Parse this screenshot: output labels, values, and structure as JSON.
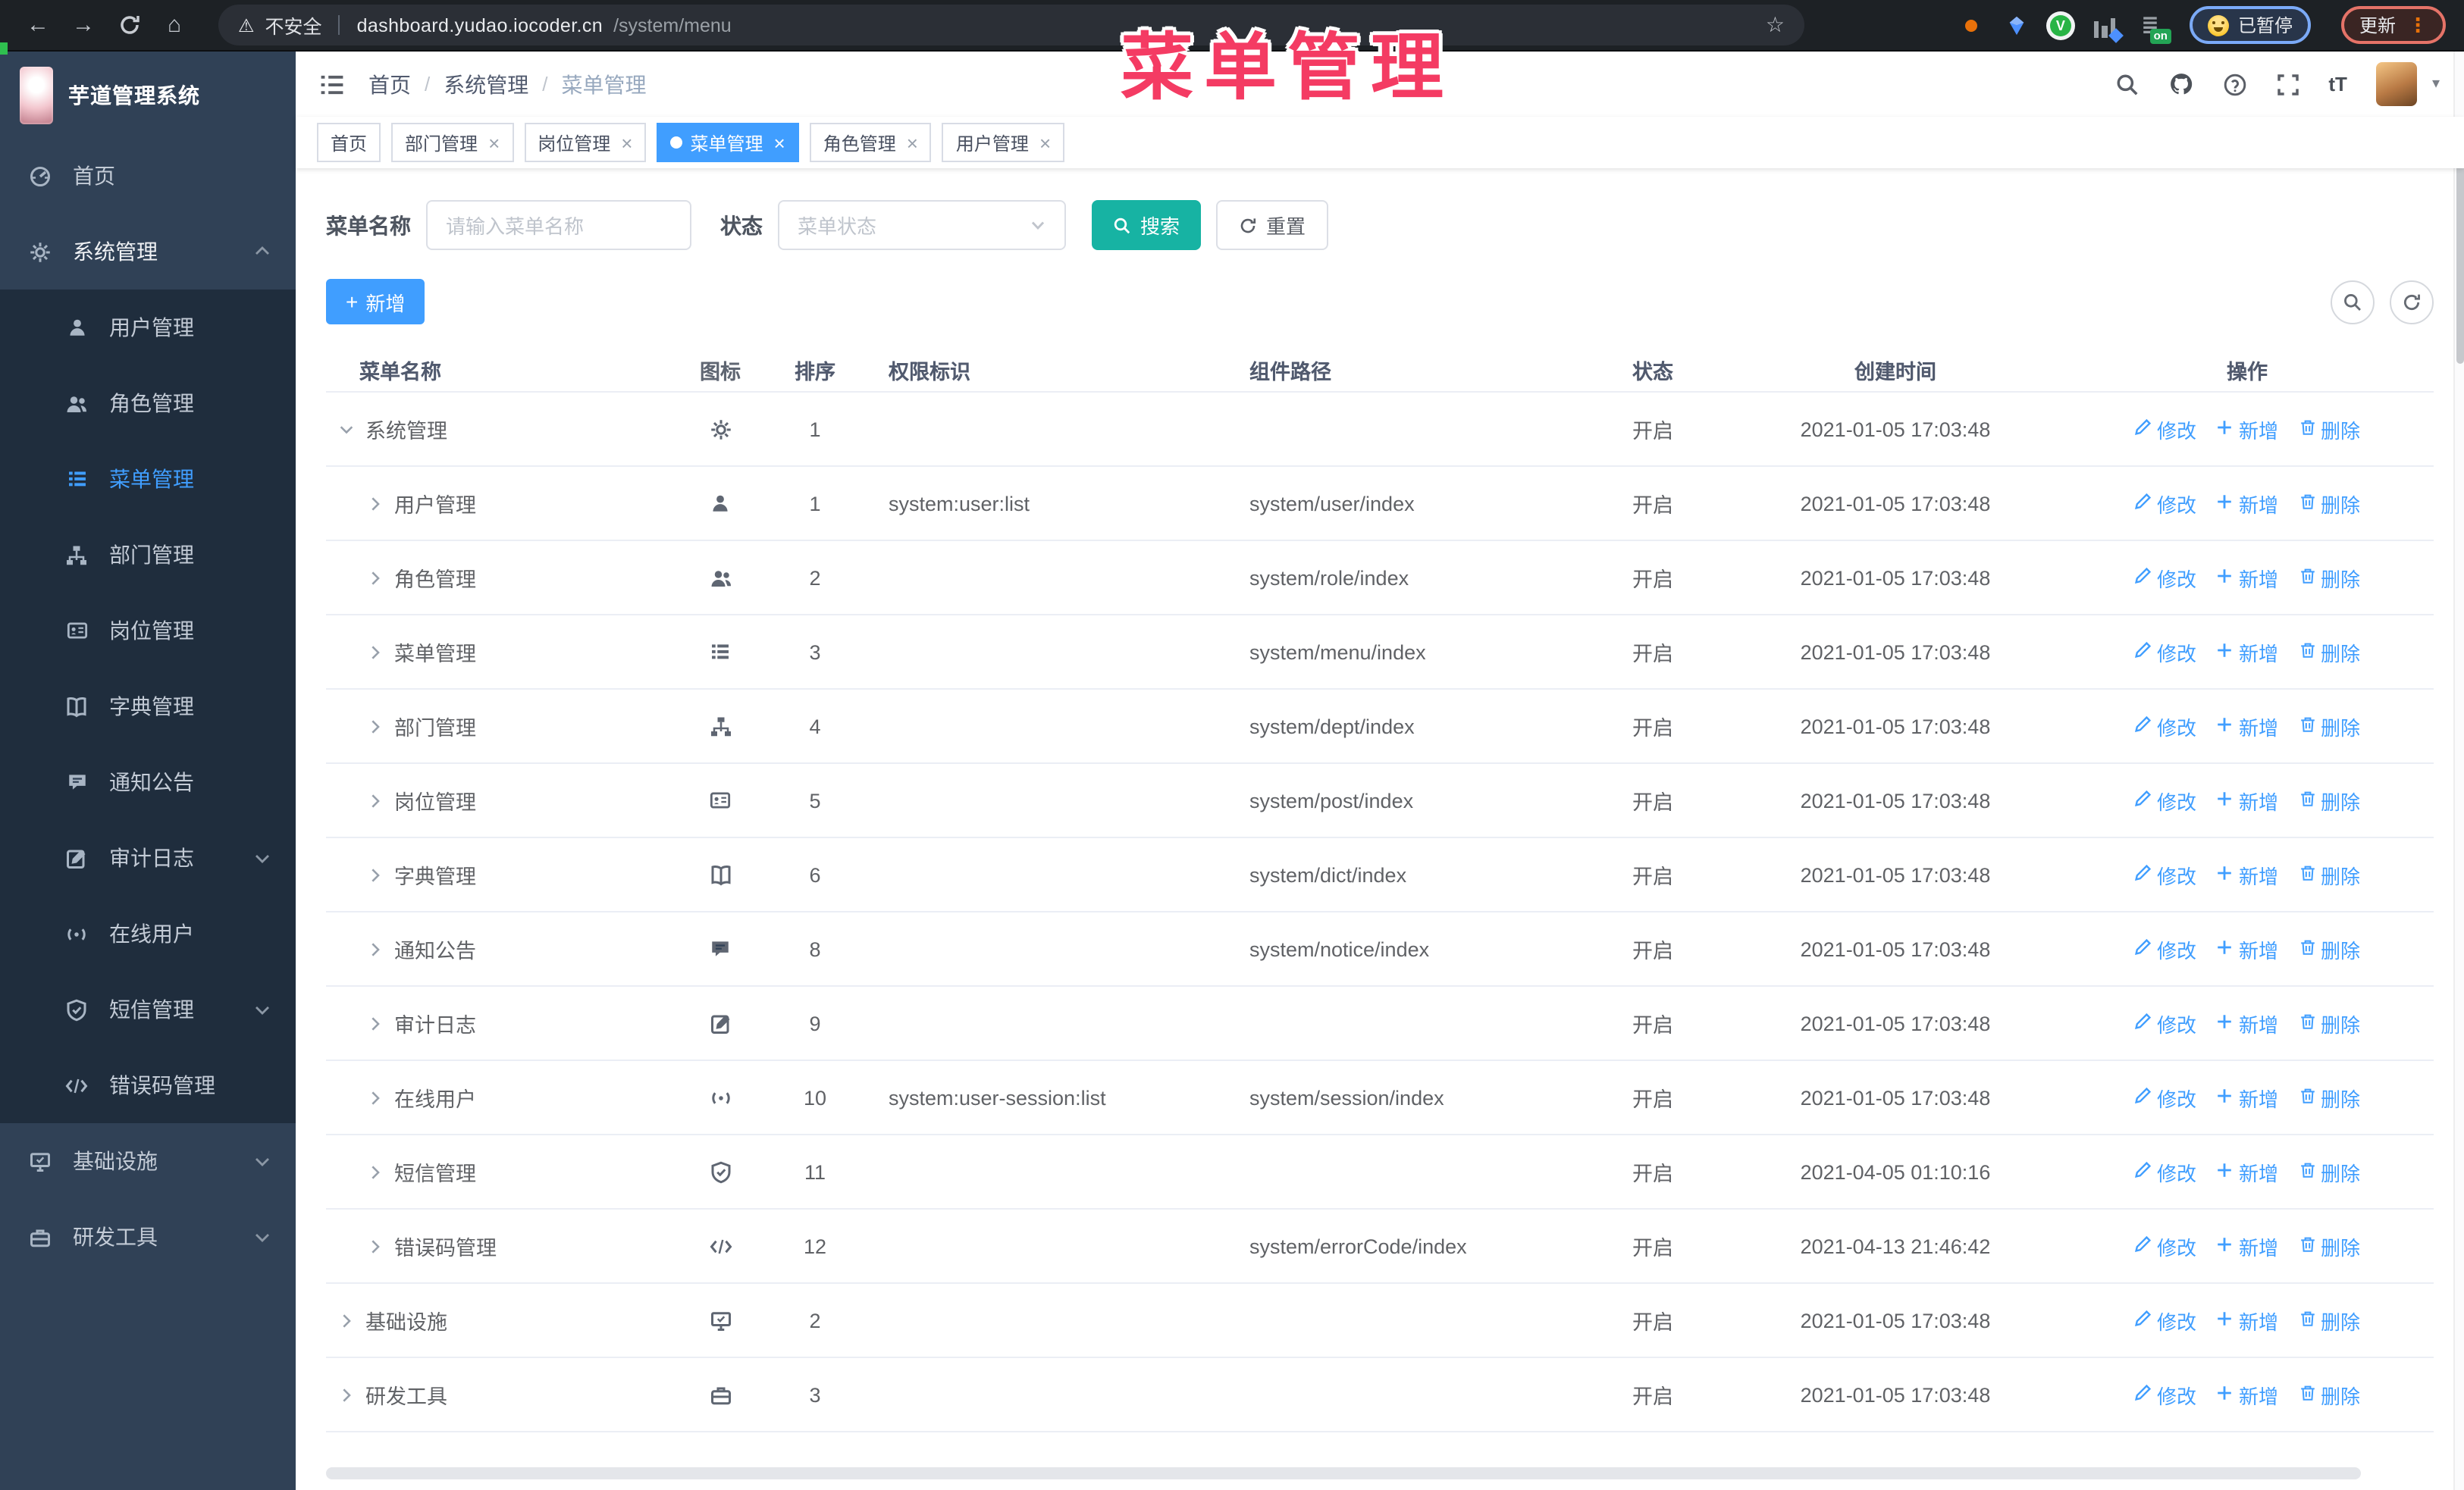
{
  "browser": {
    "security_label": "不安全",
    "url_host": "dashboard.yudao.iocoder.cn",
    "url_path": "/system/menu",
    "paused_badge": "已暂停",
    "update_button": "更新",
    "on_badge": "on"
  },
  "overlay": {
    "title": "菜单管理"
  },
  "icons": {
    "back": "←",
    "forward": "→",
    "home": "⌂",
    "star": "☆",
    "warning": "⚠",
    "more_vertical": "⋮",
    "text_size": "tT",
    "caret_down": "▾",
    "green_v": "V",
    "bars": "≣"
  },
  "sidebar": {
    "app_title": "芋道管理系统",
    "items": [
      {
        "label": "首页",
        "icon": "dashboard",
        "sub": false
      },
      {
        "label": "系统管理",
        "icon": "gear",
        "sub": false,
        "parent": true,
        "chevron": "up"
      },
      {
        "label": "用户管理",
        "icon": "user",
        "sub": true
      },
      {
        "label": "角色管理",
        "icon": "users",
        "sub": true
      },
      {
        "label": "菜单管理",
        "icon": "menu",
        "sub": true,
        "active": true
      },
      {
        "label": "部门管理",
        "icon": "tree",
        "sub": true
      },
      {
        "label": "岗位管理",
        "icon": "post",
        "sub": true
      },
      {
        "label": "字典管理",
        "icon": "dict",
        "sub": true
      },
      {
        "label": "通知公告",
        "icon": "notice",
        "sub": true
      },
      {
        "label": "审计日志",
        "icon": "audit",
        "sub": true,
        "chevron": "down"
      },
      {
        "label": "在线用户",
        "icon": "online",
        "sub": true
      },
      {
        "label": "短信管理",
        "icon": "sms",
        "sub": true,
        "chevron": "down"
      },
      {
        "label": "错误码管理",
        "icon": "code",
        "sub": true
      },
      {
        "label": "基础设施",
        "icon": "infra",
        "sub": false,
        "chevron": "down"
      },
      {
        "label": "研发工具",
        "icon": "tool",
        "sub": false,
        "chevron": "down"
      }
    ]
  },
  "header": {
    "breadcrumb": [
      "首页",
      "系统管理",
      "菜单管理"
    ]
  },
  "tags": [
    {
      "label": "首页",
      "closable": false,
      "active": false
    },
    {
      "label": "部门管理",
      "closable": true,
      "active": false
    },
    {
      "label": "岗位管理",
      "closable": true,
      "active": false
    },
    {
      "label": "菜单管理",
      "closable": true,
      "active": true
    },
    {
      "label": "角色管理",
      "closable": true,
      "active": false
    },
    {
      "label": "用户管理",
      "closable": true,
      "active": false
    }
  ],
  "search": {
    "name_label": "菜单名称",
    "name_placeholder": "请输入菜单名称",
    "status_label": "状态",
    "status_placeholder": "菜单状态",
    "search_button": "搜索",
    "reset_button": "重置"
  },
  "toolbar": {
    "add_button": "新增"
  },
  "table": {
    "columns": [
      "菜单名称",
      "图标",
      "排序",
      "权限标识",
      "组件路径",
      "状态",
      "创建时间",
      "操作"
    ],
    "actions": {
      "edit": "修改",
      "add": "新增",
      "delete": "删除"
    },
    "rows": [
      {
        "name": "系统管理",
        "icon": "gear",
        "level": 0,
        "expanded": true,
        "sort": "1",
        "permission": "",
        "path": "",
        "status": "开启",
        "time": "2021-01-05 17:03:48"
      },
      {
        "name": "用户管理",
        "icon": "user",
        "level": 1,
        "expanded": false,
        "sort": "1",
        "permission": "system:user:list",
        "path": "system/user/index",
        "status": "开启",
        "time": "2021-01-05 17:03:48"
      },
      {
        "name": "角色管理",
        "icon": "users",
        "level": 1,
        "expanded": false,
        "sort": "2",
        "permission": "",
        "path": "system/role/index",
        "status": "开启",
        "time": "2021-01-05 17:03:48"
      },
      {
        "name": "菜单管理",
        "icon": "menu",
        "level": 1,
        "expanded": false,
        "sort": "3",
        "permission": "",
        "path": "system/menu/index",
        "status": "开启",
        "time": "2021-01-05 17:03:48"
      },
      {
        "name": "部门管理",
        "icon": "tree",
        "level": 1,
        "expanded": false,
        "sort": "4",
        "permission": "",
        "path": "system/dept/index",
        "status": "开启",
        "time": "2021-01-05 17:03:48"
      },
      {
        "name": "岗位管理",
        "icon": "post",
        "level": 1,
        "expanded": false,
        "sort": "5",
        "permission": "",
        "path": "system/post/index",
        "status": "开启",
        "time": "2021-01-05 17:03:48"
      },
      {
        "name": "字典管理",
        "icon": "dict",
        "level": 1,
        "expanded": false,
        "sort": "6",
        "permission": "",
        "path": "system/dict/index",
        "status": "开启",
        "time": "2021-01-05 17:03:48"
      },
      {
        "name": "通知公告",
        "icon": "notice",
        "level": 1,
        "expanded": false,
        "sort": "8",
        "permission": "",
        "path": "system/notice/index",
        "status": "开启",
        "time": "2021-01-05 17:03:48"
      },
      {
        "name": "审计日志",
        "icon": "audit",
        "level": 1,
        "expanded": false,
        "sort": "9",
        "permission": "",
        "path": "",
        "status": "开启",
        "time": "2021-01-05 17:03:48"
      },
      {
        "name": "在线用户",
        "icon": "online",
        "level": 1,
        "expanded": false,
        "sort": "10",
        "permission": "system:user-session:list",
        "path": "system/session/index",
        "status": "开启",
        "time": "2021-01-05 17:03:48"
      },
      {
        "name": "短信管理",
        "icon": "sms",
        "level": 1,
        "expanded": false,
        "sort": "11",
        "permission": "",
        "path": "",
        "status": "开启",
        "time": "2021-04-05 01:10:16"
      },
      {
        "name": "错误码管理",
        "icon": "code",
        "level": 1,
        "expanded": false,
        "sort": "12",
        "permission": "",
        "path": "system/errorCode/index",
        "status": "开启",
        "time": "2021-04-13 21:46:42"
      },
      {
        "name": "基础设施",
        "icon": "infra",
        "level": 0,
        "expanded": false,
        "sort": "2",
        "permission": "",
        "path": "",
        "status": "开启",
        "time": "2021-01-05 17:03:48"
      },
      {
        "name": "研发工具",
        "icon": "tool",
        "level": 0,
        "expanded": false,
        "sort": "3",
        "permission": "",
        "path": "",
        "status": "开启",
        "time": "2021-01-05 17:03:48"
      }
    ]
  },
  "colors": {
    "accent": "#409eff",
    "search_button_teal": "#17b3a3",
    "sidebar_bg": "#304156",
    "submenu_bg": "#1f2d3d",
    "overlay_pink": "#f43b63"
  }
}
